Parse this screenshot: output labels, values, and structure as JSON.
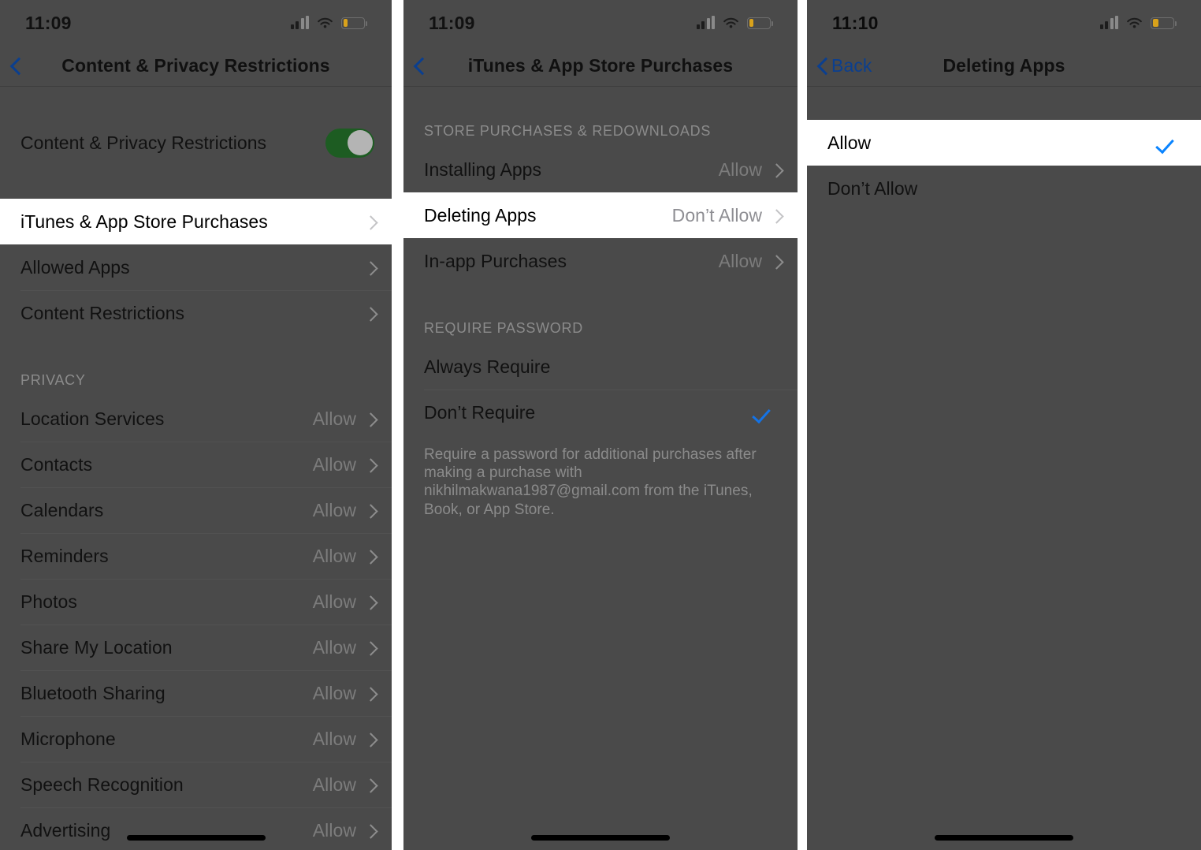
{
  "panels": [
    {
      "id": "content-privacy-restrictions",
      "status": {
        "time": "11:09",
        "signal_icon": "cellular-signal-icon",
        "wifi_icon": "wifi-icon",
        "battery_icon": "battery-low-icon",
        "battery_level_percent": 22
      },
      "nav": {
        "back_label": "",
        "back_icon": "chevron-left-icon",
        "title": "Content & Privacy Restrictions"
      },
      "toggle_row": {
        "label": "Content & Privacy Restrictions",
        "state": "on",
        "accent_color": "#34c759"
      },
      "menu_group": [
        {
          "label": "iTunes & App Store Purchases",
          "value": "",
          "accessory": "chevron-right-icon",
          "highlighted": true
        },
        {
          "label": "Allowed Apps",
          "value": "",
          "accessory": "chevron-right-icon",
          "highlighted": false
        },
        {
          "label": "Content Restrictions",
          "value": "",
          "accessory": "chevron-right-icon",
          "highlighted": false
        }
      ],
      "privacy_section": {
        "header": "PRIVACY",
        "rows": [
          {
            "label": "Location Services",
            "value": "Allow",
            "accessory": "chevron-right-icon"
          },
          {
            "label": "Contacts",
            "value": "Allow",
            "accessory": "chevron-right-icon"
          },
          {
            "label": "Calendars",
            "value": "Allow",
            "accessory": "chevron-right-icon"
          },
          {
            "label": "Reminders",
            "value": "Allow",
            "accessory": "chevron-right-icon"
          },
          {
            "label": "Photos",
            "value": "Allow",
            "accessory": "chevron-right-icon"
          },
          {
            "label": "Share My Location",
            "value": "Allow",
            "accessory": "chevron-right-icon"
          },
          {
            "label": "Bluetooth Sharing",
            "value": "Allow",
            "accessory": "chevron-right-icon"
          },
          {
            "label": "Microphone",
            "value": "Allow",
            "accessory": "chevron-right-icon"
          },
          {
            "label": "Speech Recognition",
            "value": "Allow",
            "accessory": "chevron-right-icon"
          },
          {
            "label": "Advertising",
            "value": "Allow",
            "accessory": "chevron-right-icon"
          }
        ]
      }
    },
    {
      "id": "itunes-app-store-purchases",
      "status": {
        "time": "11:09",
        "signal_icon": "cellular-signal-icon",
        "wifi_icon": "wifi-icon",
        "battery_icon": "battery-low-icon",
        "battery_level_percent": 22
      },
      "nav": {
        "back_label": "",
        "back_icon": "chevron-left-icon",
        "title": "iTunes & App Store Purchases"
      },
      "store_section": {
        "header": "STORE PURCHASES & REDOWNLOADS",
        "rows": [
          {
            "label": "Installing Apps",
            "value": "Allow",
            "accessory": "chevron-right-icon",
            "highlighted": false
          },
          {
            "label": "Deleting Apps",
            "value": "Don’t Allow",
            "accessory": "chevron-right-icon",
            "highlighted": true
          },
          {
            "label": "In-app Purchases",
            "value": "Allow",
            "accessory": "chevron-right-icon",
            "highlighted": false
          }
        ]
      },
      "password_section": {
        "header": "REQUIRE PASSWORD",
        "rows": [
          {
            "label": "Always Require",
            "checked": false
          },
          {
            "label": "Don’t Require",
            "checked": true
          }
        ],
        "footer": "Require a password for additional purchases after making a purchase with nikhilmakwana1987@gmail.com from the iTunes, Book, or App Store."
      }
    },
    {
      "id": "deleting-apps",
      "status": {
        "time": "11:10",
        "signal_icon": "cellular-signal-icon",
        "wifi_icon": "wifi-icon",
        "battery_icon": "battery-low-icon",
        "battery_level_percent": 28
      },
      "nav": {
        "back_label": "Back",
        "back_icon": "chevron-left-icon",
        "title": "Deleting Apps"
      },
      "options": [
        {
          "label": "Allow",
          "checked": true,
          "highlighted": true
        },
        {
          "label": "Don’t Allow",
          "checked": false,
          "highlighted": false
        }
      ]
    }
  ],
  "colors": {
    "dim_overlay": "#4a4a4a",
    "highlight_bg": "#ffffff",
    "accent_blue": "#0a84ff",
    "nav_blue": "#0b3f8f",
    "toggle_green": "#34c759",
    "battery_yellow": "#d9a21b"
  }
}
